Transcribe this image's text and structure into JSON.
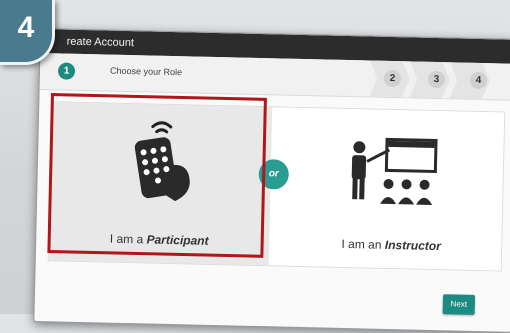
{
  "step_badge": "4",
  "window": {
    "title": "reate Account"
  },
  "steps": [
    {
      "number": "1",
      "label": "Choose your Role",
      "active": true
    },
    {
      "number": "2"
    },
    {
      "number": "3"
    },
    {
      "number": "4"
    }
  ],
  "roles": {
    "participant": {
      "prefix": "I am a",
      "name": "Participant",
      "icon": "remote-clicker-icon"
    },
    "separator": "or",
    "instructor": {
      "prefix": "I am an",
      "name": "Instructor",
      "icon": "presenter-audience-icon"
    }
  },
  "actions": {
    "next": "Next"
  },
  "colors": {
    "accent": "#1e8b82",
    "selection": "#b0161a",
    "titlebar": "#2c2c2c",
    "badge": "#4a7a8e"
  }
}
